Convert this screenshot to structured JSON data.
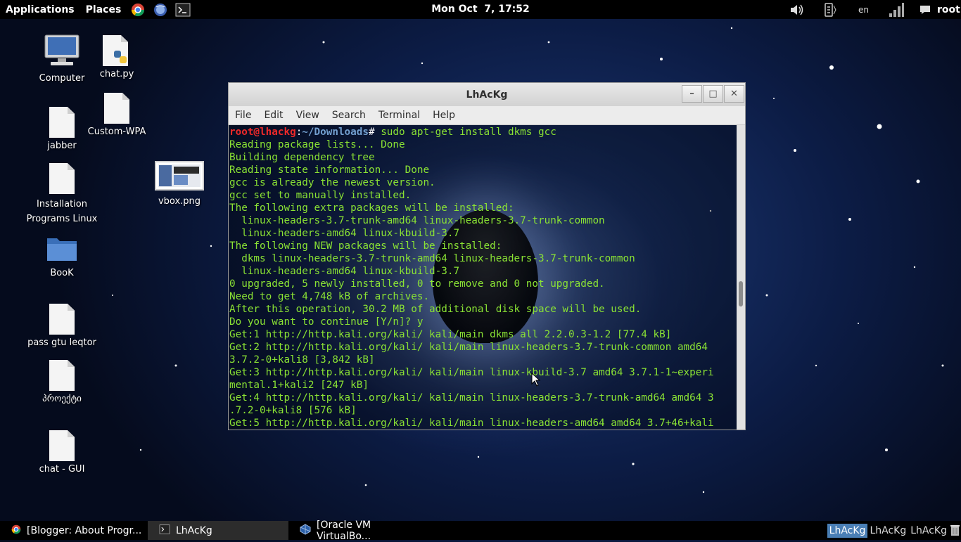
{
  "top_panel": {
    "applications": "Applications",
    "places": "Places",
    "launchers": [
      "chrome-icon",
      "web-browser-icon",
      "terminal-icon"
    ],
    "clock": "Mon Oct  7, 17:52",
    "tray": {
      "volume_icon": "speaker-icon",
      "accessibility_icon": "accessibility-icon",
      "language": "en",
      "network_icon": "signal-icon",
      "chat_icon": "chat-bubble-icon",
      "user": "root"
    }
  },
  "desktop_icons": [
    {
      "label": "Computer",
      "icon": "computer-icon"
    },
    {
      "label": "chat.py",
      "icon": "python-file-icon"
    },
    {
      "label": "jabber",
      "icon": "document-icon"
    },
    {
      "label": "Custom-WPA",
      "icon": "document-icon"
    },
    {
      "label": "Installation Programs Linux",
      "icon": "document-icon"
    },
    {
      "label": "vbox.png",
      "icon": "image-thumbnail-icon"
    },
    {
      "label": "BooK",
      "icon": "folder-icon"
    },
    {
      "label": "pass gtu leqtor",
      "icon": "document-icon"
    },
    {
      "label": "პროექტი",
      "icon": "document-icon"
    },
    {
      "label": "chat - GUI",
      "icon": "document-icon"
    }
  ],
  "terminal": {
    "title": "LhAcKg",
    "menu": [
      "File",
      "Edit",
      "View",
      "Search",
      "Terminal",
      "Help"
    ],
    "prompt_user": "root@lhackg",
    "prompt_sep": ":",
    "prompt_path": "~/Downloads",
    "prompt_end": "# ",
    "command": "sudo apt-get install dkms gcc",
    "output": [
      "Reading package lists... Done",
      "Building dependency tree",
      "Reading state information... Done",
      "gcc is already the newest version.",
      "gcc set to manually installed.",
      "The following extra packages will be installed:",
      "  linux-headers-3.7-trunk-amd64 linux-headers-3.7-trunk-common",
      "  linux-headers-amd64 linux-kbuild-3.7",
      "The following NEW packages will be installed:",
      "  dkms linux-headers-3.7-trunk-amd64 linux-headers-3.7-trunk-common",
      "  linux-headers-amd64 linux-kbuild-3.7",
      "0 upgraded, 5 newly installed, 0 to remove and 0 not upgraded.",
      "Need to get 4,748 kB of archives.",
      "After this operation, 30.2 MB of additional disk space will be used.",
      "Do you want to continue [Y/n]? y",
      "Get:1 http://http.kali.org/kali/ kali/main dkms all 2.2.0.3-1.2 [77.4 kB]",
      "Get:2 http://http.kali.org/kali/ kali/main linux-headers-3.7-trunk-common amd64",
      "3.7.2-0+kali8 [3,842 kB]",
      "Get:3 http://http.kali.org/kali/ kali/main linux-kbuild-3.7 amd64 3.7.1-1~experi",
      "mental.1+kali2 [247 kB]",
      "Get:4 http://http.kali.org/kali/ kali/main linux-headers-3.7-trunk-amd64 amd64 3",
      ".7.2-0+kali8 [576 kB]",
      "Get:5 http://http.kali.org/kali/ kali/main linux-headers-amd64 amd64 3.7+46+kali"
    ]
  },
  "taskbar": {
    "tasks": [
      {
        "label": "[Blogger: About Progr...",
        "icon": "chrome-icon"
      },
      {
        "label": "LhAcKg",
        "icon": "terminal-icon"
      },
      {
        "label": "[Oracle VM VirtualBo...",
        "icon": "virtualbox-icon"
      }
    ],
    "workspaces": [
      "LhAcKg",
      "LhAcKg",
      "LhAcKg"
    ]
  }
}
